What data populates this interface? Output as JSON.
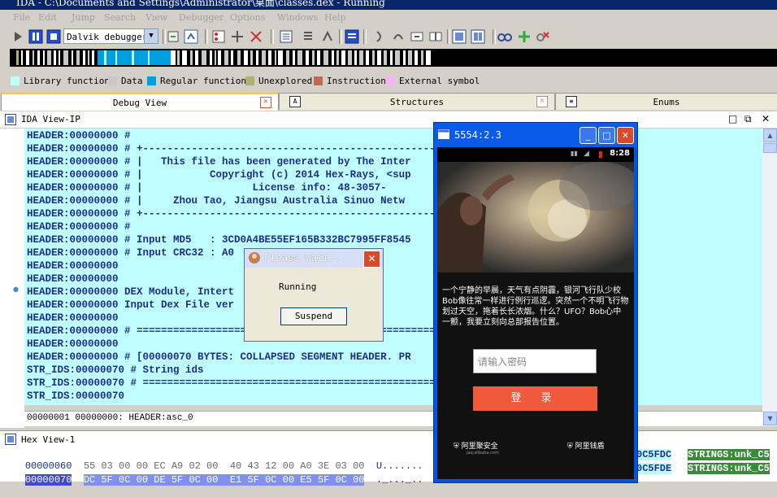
{
  "window": {
    "title": "IDA - C:\\Documents and Settings\\Administrator\\桌面\\classes.dex - Running"
  },
  "menu": [
    "File",
    "Edit",
    "Jump",
    "Search",
    "View",
    "Debugger",
    "Options",
    "Windows",
    "Help"
  ],
  "toolbar": {
    "debugger_select": "Dalvik debugger"
  },
  "legend": [
    {
      "label": "Library function",
      "color": "#c0ffff"
    },
    {
      "label": "Data",
      "color": "#c8c8c8"
    },
    {
      "label": "Regular function",
      "color": "#00a0e0"
    },
    {
      "label": "Unexplored",
      "color": "#b0b070"
    },
    {
      "label": "Instruction",
      "color": "#c06a50"
    },
    {
      "label": "External symbol",
      "color": "#ffb0ff"
    }
  ],
  "tabs": [
    {
      "label": "Debug View",
      "active": true
    },
    {
      "label": "Structures",
      "active": false
    },
    {
      "label": "Enums",
      "active": false
    }
  ],
  "ida_view": {
    "title": "IDA View-IP",
    "lines": [
      "HEADER:00000000 #",
      "HEADER:00000000 # +-----------------------------------------------------",
      "HEADER:00000000 # |   This file has been generated by The Inter",
      "HEADER:00000000 # |           Copyright (c) 2014 Hex-Rays, <sup",
      "HEADER:00000000 # |                  License info: 48-3057-",
      "HEADER:00000000 # |     Zhou Tao, Jiangsu Australia Sinuo Netw",
      "HEADER:00000000 # +-----------------------------------------------------",
      "HEADER:00000000 #",
      "HEADER:00000000 # Input MD5   : 3CD0A4BE55EF165B332BC7995FF8545",
      "HEADER:00000000 # Input CRC32 : A0",
      "HEADER:00000000",
      "HEADER:00000000",
      "HEADER:00000000 DEX Module, Intert",
      "HEADER:00000000 Input Dex File ver",
      "HEADER:00000000",
      "HEADER:00000000 # ======================================================",
      "HEADER:00000000",
      "HEADER:00000000 # [00000070 BYTES: COLLAPSED SEGMENT HEADER. PR",
      "STR_IDS:00000070 # String ids",
      "STR_IDS:00000070 # ======================================================",
      "STR_IDS:00000070"
    ],
    "status": "00000001 00000000: HEADER:asc_0"
  },
  "hex_view": {
    "title": "Hex View-1",
    "rows": [
      {
        "addr": "00000060",
        "bytes": "55 03 00 00 EC A9 02 00  40 43 12 00 A0 3E 03 00",
        "ascii": "U......."
      },
      {
        "addr": "00000070",
        "bytes": "DC 5F 0C 00 DE 5F 0C 00  E1 5F 0C 00 E5 5F 0C 00",
        "ascii": "._..._.."
      }
    ],
    "right_addr": [
      "0C5FDC",
      "0C5FDE"
    ],
    "right_strings": [
      "STRINGS:unk_C5",
      "STRINGS:unk_C5"
    ]
  },
  "wait_dialog": {
    "title": "Please wait...",
    "message": "Running",
    "button": "Suspend"
  },
  "emulator": {
    "title": "5554:2.3",
    "time": "8:28",
    "story": "一个宁静的早晨，天气有点阴霾，银河飞行队少校Bob像往常一样进行例行巡逻。突然一个不明飞行物划过天空，拖着长长浓烟。什么？UFO？Bob心中一颤，我要立刻向总部报告位置。",
    "password_placeholder": "请输入密码",
    "login_button": "登 录",
    "footer_left": "阿里聚安全",
    "footer_left_sub": "jaq.alibaba.com",
    "footer_right": "阿里钱盾"
  }
}
